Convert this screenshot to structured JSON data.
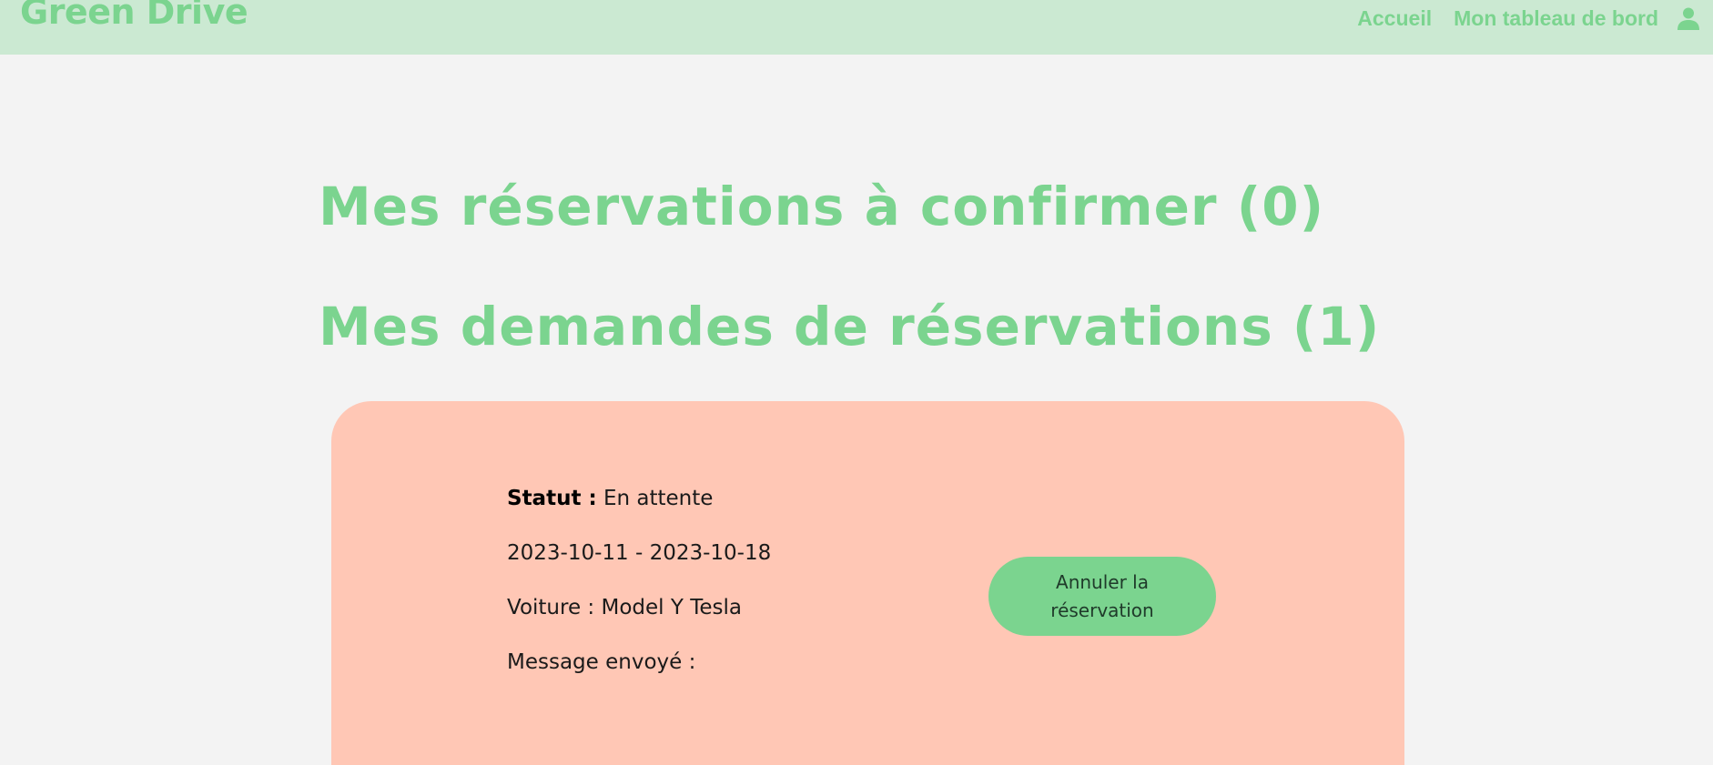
{
  "navbar": {
    "brand": "Green Drive",
    "links": [
      {
        "label": "Accueil"
      },
      {
        "label": "Mon tableau de bord"
      }
    ],
    "user_icon": "user-icon"
  },
  "sections": {
    "to_confirm_title": "Mes réservations à confirmer (0)",
    "requests_title": "Mes demandes de réservations (1)"
  },
  "reservation": {
    "status_label": "Statut :",
    "status_value": "En attente",
    "dates": "2023-10-11 - 2023-10-18",
    "car": "Voiture : Model Y Tesla",
    "message": "Message envoyé :",
    "cancel_label": "Annuler la réservation"
  },
  "colors": {
    "primary_green": "#7bd48f",
    "navbar_bg": "#cbe9d2",
    "card_bg": "#ffc7b5",
    "page_bg": "#f3f3f3"
  }
}
